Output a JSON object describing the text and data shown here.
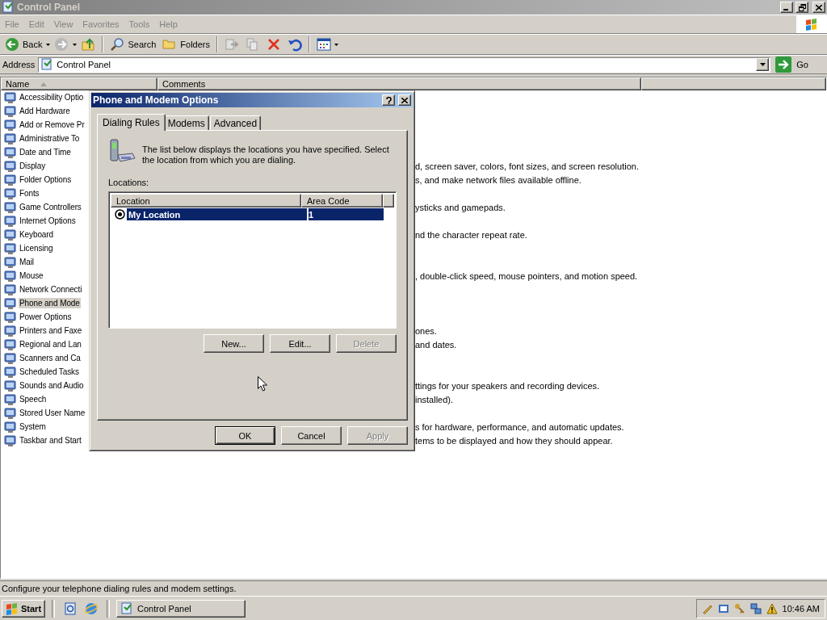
{
  "window": {
    "title": "Control Panel"
  },
  "menu": [
    {
      "label": "File"
    },
    {
      "label": "Edit"
    },
    {
      "label": "View"
    },
    {
      "label": "Favorites"
    },
    {
      "label": "Tools"
    },
    {
      "label": "Help"
    }
  ],
  "toolbar": {
    "back": "Back",
    "search": "Search",
    "folders": "Folders"
  },
  "address": {
    "label": "Address",
    "value": "Control Panel",
    "go": "Go"
  },
  "list": {
    "columns": [
      "Name",
      "Comments"
    ],
    "items": [
      {
        "name": "Accessibility Optio",
        "selected": false
      },
      {
        "name": "Add Hardware",
        "selected": false
      },
      {
        "name": "Add or Remove Pr",
        "selected": false
      },
      {
        "name": "Administrative To",
        "selected": false
      },
      {
        "name": "Date and Time",
        "selected": false
      },
      {
        "name": "Display",
        "comment": "d, screen saver, colors, font sizes, and screen resolution.",
        "selected": false
      },
      {
        "name": "Folder Options",
        "comment": "s, and make network files available offline.",
        "selected": false
      },
      {
        "name": "Fonts",
        "selected": false
      },
      {
        "name": "Game Controllers",
        "comment": "ysticks and gamepads.",
        "selected": false
      },
      {
        "name": "Internet Options",
        "selected": false
      },
      {
        "name": "Keyboard",
        "comment": "nd the character repeat rate.",
        "selected": false
      },
      {
        "name": "Licensing",
        "selected": false
      },
      {
        "name": "Mail",
        "selected": false
      },
      {
        "name": "Mouse",
        "comment": ", double-click speed, mouse pointers, and motion speed.",
        "selected": false
      },
      {
        "name": "Network Connecti",
        "selected": false
      },
      {
        "name": "Phone and Mode",
        "selected": true
      },
      {
        "name": "Power Options",
        "selected": false
      },
      {
        "name": "Printers and Faxe",
        "comment": "ones.",
        "selected": false
      },
      {
        "name": "Regional and Lan",
        "comment": "and dates.",
        "selected": false
      },
      {
        "name": "Scanners and Ca",
        "selected": false
      },
      {
        "name": "Scheduled Tasks",
        "selected": false
      },
      {
        "name": "Sounds and Audio",
        "comment": "ttings for your speakers and recording devices.",
        "selected": false
      },
      {
        "name": "Speech",
        "comment": "installed).",
        "selected": false
      },
      {
        "name": "Stored User Name",
        "selected": false
      },
      {
        "name": "System",
        "comment": "s for hardware, performance, and automatic updates.",
        "selected": false
      },
      {
        "name": "Taskbar and Start",
        "comment": "tems to be displayed and how they should appear.",
        "selected": false
      }
    ]
  },
  "status_bar": "Configure your telephone dialing rules and modem settings.",
  "dialog": {
    "title": "Phone and Modem Options",
    "tabs": [
      {
        "label": "Dialing Rules",
        "selected": true
      },
      {
        "label": "Modems",
        "selected": false
      },
      {
        "label": "Advanced",
        "selected": false
      }
    ],
    "description": "The list below displays the locations you have specified. Select the location from which you are dialing.",
    "locations_label": "Locations:",
    "table": {
      "columns": [
        "Location",
        "Area Code"
      ],
      "rows": [
        {
          "location": "My Location",
          "area_code": "1",
          "current": true,
          "selected": true
        }
      ]
    },
    "buttons": [
      {
        "label": "New...",
        "disabled": false
      },
      {
        "label": "Edit...",
        "disabled": false
      },
      {
        "label": "Delete",
        "disabled": true
      }
    ],
    "footer_buttons": [
      {
        "label": "OK",
        "default": true,
        "disabled": false
      },
      {
        "label": "Cancel",
        "default": false,
        "disabled": false
      },
      {
        "label": "Apply",
        "default": false,
        "disabled": true
      }
    ]
  },
  "taskbar": {
    "start": "Start",
    "tasks": [
      {
        "label": "Control Panel",
        "selected": false
      }
    ],
    "clock": "10:46 AM"
  }
}
